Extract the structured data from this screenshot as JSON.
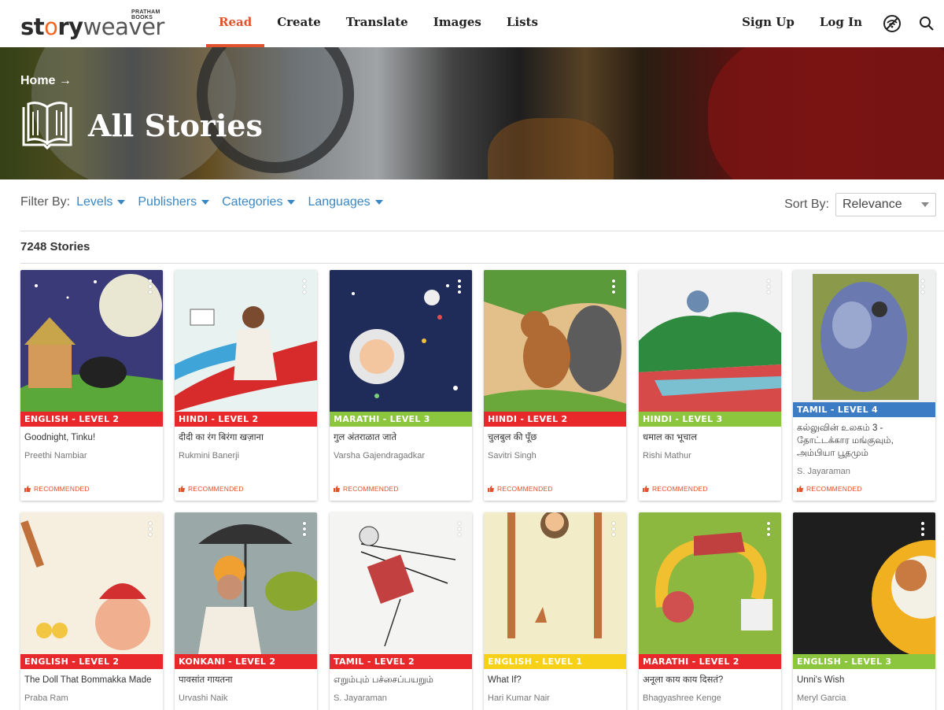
{
  "logo": {
    "brand_dark": "st",
    "brand_sun": "o",
    "brand_dark2": "ry",
    "brand_light": "weaver",
    "publisher": "PRATHAM BOOKS"
  },
  "nav": {
    "items": [
      {
        "label": "Read",
        "active": true
      },
      {
        "label": "Create"
      },
      {
        "label": "Translate"
      },
      {
        "label": "Images"
      },
      {
        "label": "Lists"
      }
    ],
    "sign_up": "Sign Up",
    "log_in": "Log In",
    "icons": [
      "offline-wifi-icon",
      "search-icon"
    ]
  },
  "hero": {
    "breadcrumb": "Home →",
    "title": "All Stories",
    "icon": "open-book-icon"
  },
  "filters": {
    "label": "Filter By:",
    "items": [
      "Levels",
      "Publishers",
      "Categories",
      "Languages"
    ],
    "sort_label": "Sort By:",
    "sort_value": "Relevance"
  },
  "results": {
    "count_text": "7248 Stories"
  },
  "level_colors": {
    "red": "#e8282b",
    "green": "#8cc63f",
    "blue": "#3b7cc4",
    "yellow": "#f7d117"
  },
  "cards": [
    {
      "level": "ENGLISH - LEVEL 2",
      "color": "red",
      "title": "Goodnight, Tinku!",
      "author": "Preethi Nambiar",
      "rec": "RECOMMENDED"
    },
    {
      "level": "HINDI - LEVEL 2",
      "color": "red",
      "title": "दीदी का रंग बिरंगा खज़ाना",
      "author": "Rukmini Banerji",
      "rec": "RECOMMENDED"
    },
    {
      "level": "MARATHI - LEVEL 3",
      "color": "green",
      "title": "गुल अंतराळात जाते",
      "author": "Varsha Gajendragadkar",
      "rec": "RECOMMENDED"
    },
    {
      "level": "HINDI - LEVEL 2",
      "color": "red",
      "title": "चुलबुल की पूँछ",
      "author": "Savitri Singh",
      "rec": "RECOMMENDED"
    },
    {
      "level": "HINDI - LEVEL 3",
      "color": "green",
      "title": "धमाल का भूचाल",
      "author": "Rishi Mathur",
      "rec": "RECOMMENDED"
    },
    {
      "level": "TAMIL - LEVEL 4",
      "color": "blue",
      "title": "கல்லுவின் உலகம் 3 - தோட்டக்கார மங்குவும், அம்பியா பூதமும்",
      "author": "S. Jayaraman",
      "rec": "RECOMMENDED"
    },
    {
      "level": "ENGLISH - LEVEL 2",
      "color": "red",
      "title": "The Doll That Bommakka Made",
      "author": "Praba Ram"
    },
    {
      "level": "KONKANI - LEVEL 2",
      "color": "red",
      "title": "पावसांत गायतना",
      "author": "Urvashi Naik"
    },
    {
      "level": "TAMIL - LEVEL 2",
      "color": "red",
      "title": "எறும்பும் பச்சைப்பயறும்",
      "author": "S. Jayaraman"
    },
    {
      "level": "ENGLISH - LEVEL 1",
      "color": "yellow",
      "title": "What If?",
      "author": "Hari Kumar Nair"
    },
    {
      "level": "MARATHI - LEVEL 2",
      "color": "red",
      "title": "अनूला काय काय दिसतं?",
      "author": "Bhagyashree Kenge"
    },
    {
      "level": "ENGLISH - LEVEL 3",
      "color": "green",
      "title": "Unni's Wish",
      "author": "Meryl Garcia"
    }
  ]
}
